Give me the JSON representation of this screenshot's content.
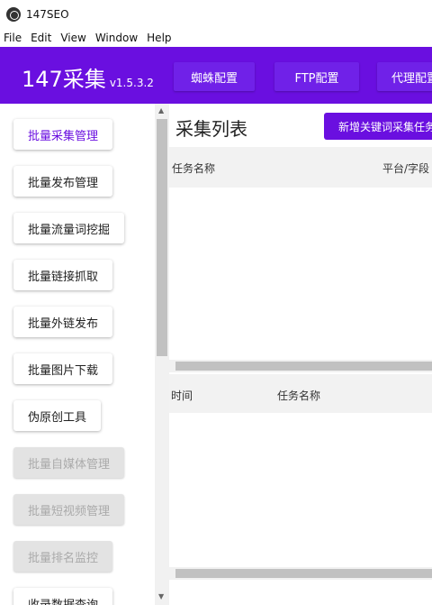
{
  "window": {
    "title": "147SEO"
  },
  "menu": [
    "File",
    "Edit",
    "View",
    "Window",
    "Help"
  ],
  "header": {
    "brand": "147采集",
    "version": "v1.5.3.2",
    "nav": [
      "蜘蛛配置",
      "FTP配置",
      "代理配置"
    ]
  },
  "sidebar": {
    "items": [
      {
        "label": "批量采集管理",
        "state": "active"
      },
      {
        "label": "批量发布管理",
        "state": "normal"
      },
      {
        "label": "批量流量词挖掘",
        "state": "normal"
      },
      {
        "label": "批量链接抓取",
        "state": "normal"
      },
      {
        "label": "批量外链发布",
        "state": "normal"
      },
      {
        "label": "批量图片下载",
        "state": "normal"
      },
      {
        "label": "伪原创工具",
        "state": "normal"
      },
      {
        "label": "批量自媒体管理",
        "state": "disabled"
      },
      {
        "label": "批量短视频管理",
        "state": "disabled"
      },
      {
        "label": "批量排名监控",
        "state": "disabled"
      },
      {
        "label": "收录数据查询",
        "state": "normal"
      }
    ]
  },
  "main": {
    "title": "采集列表",
    "add_button": "新增关键词采集任务",
    "table1": {
      "columns": [
        "任务名称",
        "平台/字段"
      ]
    },
    "table2": {
      "columns": [
        "时间",
        "任务名称"
      ]
    }
  },
  "colors": {
    "accent": "#6a0fe0",
    "disabled_bg": "#e3e3e3"
  }
}
